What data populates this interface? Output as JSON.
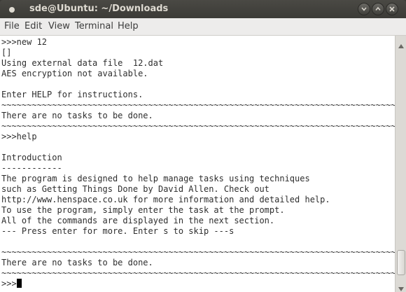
{
  "window": {
    "title": "sde@Ubuntu: ~/Downloads"
  },
  "menubar": {
    "items": [
      "File",
      "Edit",
      "View",
      "Terminal",
      "Help"
    ]
  },
  "terminal": {
    "lines": [
      ">>>new 12",
      "[]",
      "Using external data file  12.dat",
      "AES encryption not available.",
      "",
      "Enter HELP for instructions.",
      "~~~~~~~~~~~~~~~~~~~~~~~~~~~~~~~~~~~~~~~~~~~~~~~~~~~~~~~~~~~~~~~~~~~~~~~~~~~~~~",
      "There are no tasks to be done.",
      "~~~~~~~~~~~~~~~~~~~~~~~~~~~~~~~~~~~~~~~~~~~~~~~~~~~~~~~~~~~~~~~~~~~~~~~~~~~~~~",
      ">>>help",
      "",
      "Introduction",
      "------------",
      "The program is designed to help manage tasks using techniques",
      "such as Getting Things Done by David Allen. Check out",
      "http://www.henspace.co.uk for more information and detailed help.",
      "To use the program, simply enter the task at the prompt.",
      "All of the commands are displayed in the next section.",
      "--- Press enter for more. Enter s to skip ---s",
      "",
      "~~~~~~~~~~~~~~~~~~~~~~~~~~~~~~~~~~~~~~~~~~~~~~~~~~~~~~~~~~~~~~~~~~~~~~~~~~~~~~",
      "There are no tasks to be done.",
      "~~~~~~~~~~~~~~~~~~~~~~~~~~~~~~~~~~~~~~~~~~~~~~~~~~~~~~~~~~~~~~~~~~~~~~~~~~~~~~"
    ],
    "prompt": ">>>"
  },
  "colors": {
    "titlebar": "#3c3b37",
    "menubar": "#edeceb",
    "terminal_bg": "#ffffff",
    "terminal_text": "#2e2e2e"
  },
  "icons": [
    "app-icon",
    "minimize-icon",
    "maximize-icon",
    "close-icon",
    "scroll-up-icon",
    "scroll-down-icon"
  ]
}
